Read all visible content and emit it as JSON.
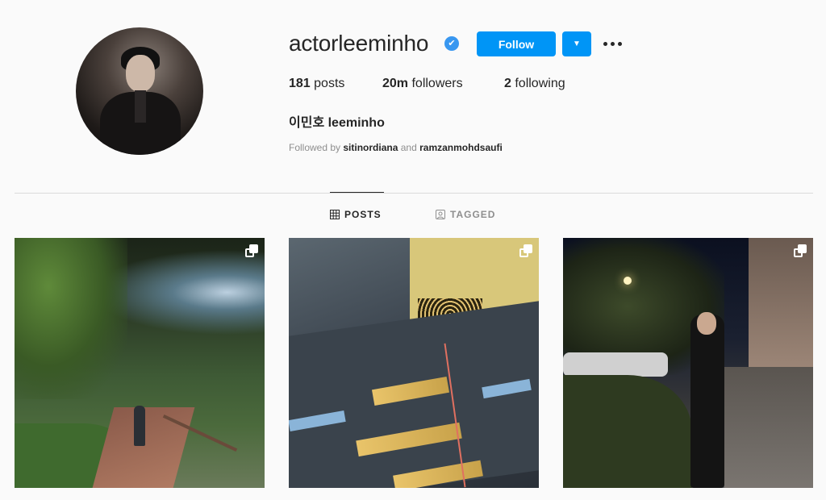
{
  "profile": {
    "username": "actorleeminho",
    "verified_mark": "✔",
    "full_name": "이민호 leeminho",
    "follow_label": "Follow",
    "dropdown_icon": "chevron-down-icon",
    "more_icon": "more-options-icon"
  },
  "stats": [
    {
      "count": "181",
      "label": " posts"
    },
    {
      "count": "20m",
      "label": " followers"
    },
    {
      "count": "2",
      "label": " following"
    }
  ],
  "followed_by": {
    "prefix": "Followed by ",
    "user1": "sitinordiana",
    "separator": " and ",
    "user2": "ramzanmohdsaufi"
  },
  "tabs": [
    {
      "label": "POSTS",
      "icon": "grid-icon",
      "active": true
    },
    {
      "label": "TAGGED",
      "icon": "tagged-icon",
      "active": false
    }
  ],
  "posts": [
    {
      "icon": "multiple-images-icon"
    },
    {
      "icon": "multiple-images-icon"
    },
    {
      "icon": "multiple-images-icon"
    }
  ],
  "colors": {
    "accent": "#0095f6",
    "verified": "#3897f0",
    "text": "#262626",
    "muted": "#8e8e8e",
    "background": "#fafafa"
  }
}
